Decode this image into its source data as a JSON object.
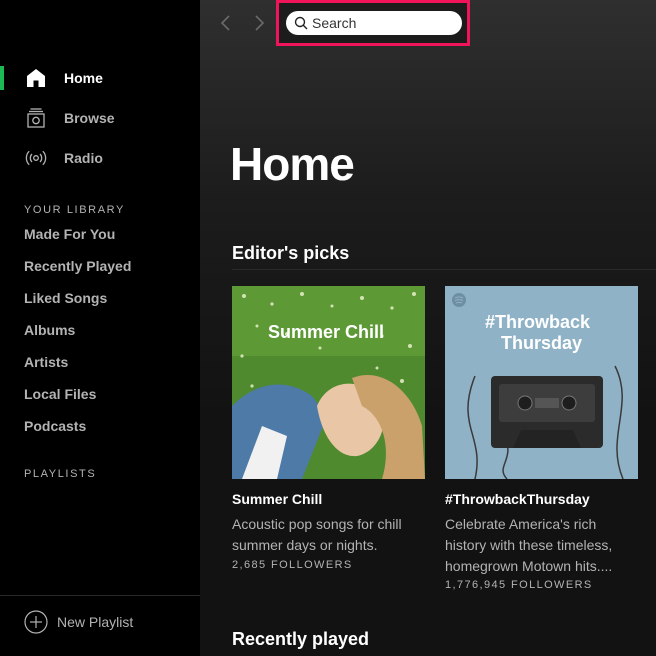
{
  "sidebar": {
    "nav": [
      {
        "label": "Home",
        "icon": "home-icon",
        "active": true
      },
      {
        "label": "Browse",
        "icon": "browse-icon",
        "active": false
      },
      {
        "label": "Radio",
        "icon": "radio-icon",
        "active": false
      }
    ],
    "library_title": "YOUR LIBRARY",
    "library": [
      "Made For You",
      "Recently Played",
      "Liked Songs",
      "Albums",
      "Artists",
      "Local Files",
      "Podcasts"
    ],
    "playlists_title": "PLAYLISTS",
    "new_playlist_label": "New Playlist"
  },
  "topbar": {
    "search_placeholder": "Search"
  },
  "main": {
    "title": "Home",
    "editors_picks_title": "Editor's picks",
    "cards": [
      {
        "cover_text": "Summer Chill",
        "title": "Summer Chill",
        "description": "Acoustic pop songs for chill summer days or nights.",
        "followers": "2,685 FOLLOWERS"
      },
      {
        "cover_text_line1": "#Throwback",
        "cover_text_line2": "Thursday",
        "title": "#ThrowbackThursday",
        "description": "Celebrate America's rich history with these timeless, homegrown Motown hits....",
        "followers": "1,776,945 FOLLOWERS"
      }
    ],
    "recently_played_title": "Recently played"
  },
  "colors": {
    "sidebar_bg": "#000000",
    "main_bg": "#121212",
    "accent_green": "#1db954",
    "highlight": "#f0145a",
    "muted_text": "#b3b3b3",
    "throwback_bg": "#8fb2c6"
  }
}
